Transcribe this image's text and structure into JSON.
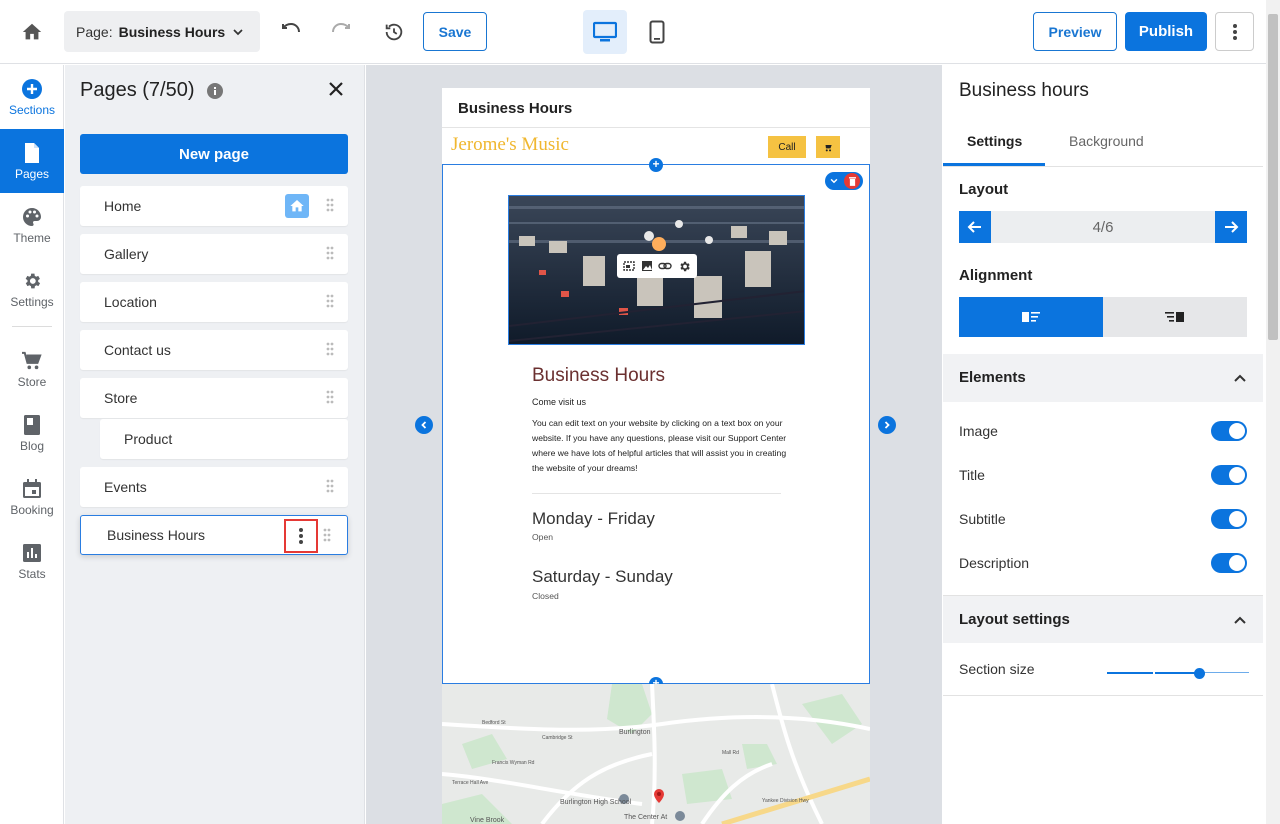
{
  "topbar": {
    "page_label": "Page:",
    "page_value": "Business Hours",
    "save": "Save",
    "preview": "Preview",
    "publish": "Publish"
  },
  "rail": {
    "items": [
      {
        "label": "Sections",
        "icon": "plus-circle-icon"
      },
      {
        "label": "Pages",
        "icon": "page-icon"
      },
      {
        "label": "Theme",
        "icon": "palette-icon"
      },
      {
        "label": "Settings",
        "icon": "gear-icon"
      },
      {
        "label": "Store",
        "icon": "cart-icon"
      },
      {
        "label": "Blog",
        "icon": "book-icon"
      },
      {
        "label": "Booking",
        "icon": "calendar-icon"
      },
      {
        "label": "Stats",
        "icon": "chart-icon"
      }
    ]
  },
  "pages_panel": {
    "title": "Pages (7/50)",
    "new_page": "New page",
    "items": [
      "Home",
      "Gallery",
      "Location",
      "Contact us",
      "Store",
      "Product",
      "Events",
      "Business Hours"
    ]
  },
  "site": {
    "tab_title": "Business Hours",
    "brand": "Jerome's Music",
    "call": "Call",
    "section_title": "Business Hours",
    "subtitle": "Come visit us",
    "description": "You can edit text on your website by clicking on a text box on your website. If you have any questions, please visit our Support Center where we have lots of helpful articles that will assist you in creating the website of your dreams!",
    "hours": [
      {
        "days": "Monday - Friday",
        "status": "Open"
      },
      {
        "days": "Saturday - Sunday",
        "status": "Closed"
      }
    ],
    "map_labels": [
      "Burlington",
      "Burlington High School",
      "The Center At",
      "Vine Brook",
      "Bedford St",
      "Cambridge St",
      "Terrace Hall Ave",
      "Francis Wyman Rd",
      "Mall Rd",
      "Yankee Division Hwy"
    ]
  },
  "right_panel": {
    "title": "Business hours",
    "tabs": [
      "Settings",
      "Background"
    ],
    "layout_label": "Layout",
    "layout_value": "4/6",
    "alignment_label": "Alignment",
    "elements_label": "Elements",
    "elements": [
      "Image",
      "Title",
      "Subtitle",
      "Description"
    ],
    "layout_settings_label": "Layout settings",
    "section_size_label": "Section size",
    "section_size_level": 0.65
  },
  "colors": {
    "accent": "#0b74de",
    "brand": "#f0b72f",
    "highlight": "#e53935"
  }
}
